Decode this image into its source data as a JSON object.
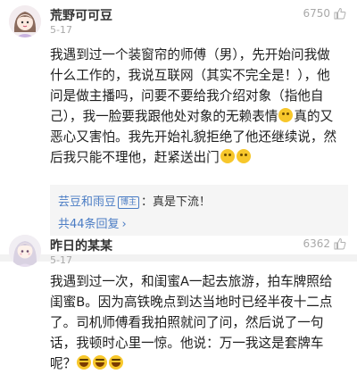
{
  "comments": [
    {
      "username": "荒野可可豆",
      "date": "5-17",
      "likes": "6750",
      "lines": [
        "我遇到过一个装窗帘的师傅（男），先开始问我做",
        "什么工作的，我说互联网（其实不完全是！），他",
        "问是做主播吗，问要不要给我介绍对象（指他自",
        "己），我一脸要我跟他处对象的无赖表情",
        "真的又",
        "恶心又害怕。我先开始礼貌拒绝了他还继续说，然",
        "后我只能不理他，赶紧送出门"
      ],
      "reply": {
        "user": "芸豆和雨豆",
        "badge": "博主",
        "text": "：真是下流！",
        "count": "共44条回复",
        "chevron": "›"
      }
    },
    {
      "username": "昨日的某某",
      "date": "5-17",
      "likes": "6362",
      "lines": [
        "我遇到过一次，和闺蜜A一起去旅游，拍车牌照给",
        "闺蜜B。因为高铁晚点到达当地时已经半夜十二点",
        "了。司机师傅看我拍照就问了问，然后说了一句",
        "话，我顿时心里一惊。他说：万一我这是套牌车",
        "呢？"
      ]
    }
  ],
  "icons": {
    "like": "thumbs-up-icon",
    "emoji_grin": "grin-face-icon",
    "emoji_laugh": "laugh-cry-icon"
  },
  "colors": {
    "link": "#4a7cc4",
    "muted": "#a8a8a8",
    "reply_bg": "#f5f5f5"
  }
}
